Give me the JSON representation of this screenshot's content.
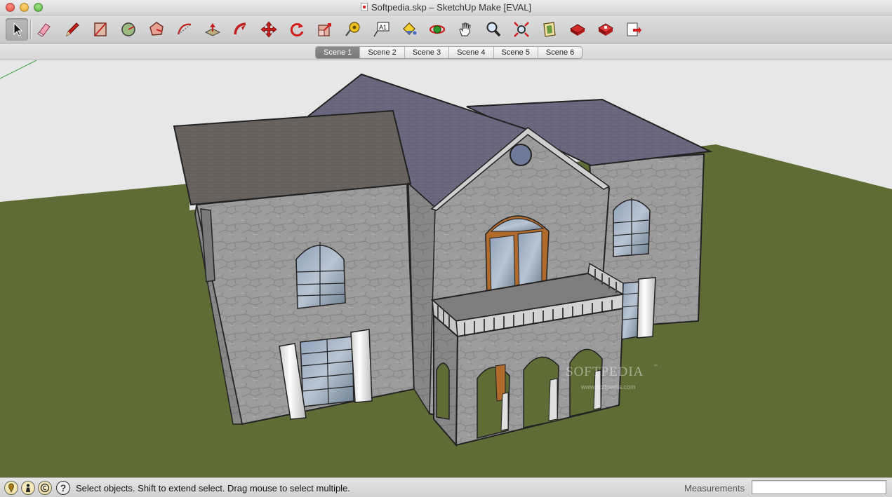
{
  "window": {
    "title": "Softpedia.skp – SketchUp Make [EVAL]"
  },
  "toolbar": {
    "tools": [
      {
        "name": "select-tool-icon",
        "active": true
      },
      {
        "name": "eraser-tool-icon"
      },
      {
        "name": "pencil-tool-icon"
      },
      {
        "name": "rectangle-tool-icon"
      },
      {
        "name": "circle-tool-icon"
      },
      {
        "name": "polygon-tool-icon"
      },
      {
        "name": "arc-tool-icon"
      },
      {
        "name": "push-pull-tool-icon"
      },
      {
        "name": "follow-me-tool-icon"
      },
      {
        "name": "move-tool-icon"
      },
      {
        "name": "rotate-tool-icon"
      },
      {
        "name": "scale-tool-icon"
      },
      {
        "name": "tape-measure-tool-icon"
      },
      {
        "name": "text-tool-icon",
        "glyph": "A1"
      },
      {
        "name": "paint-bucket-tool-icon"
      },
      {
        "name": "orbit-tool-icon"
      },
      {
        "name": "pan-tool-icon"
      },
      {
        "name": "zoom-tool-icon"
      },
      {
        "name": "zoom-extents-tool-icon"
      },
      {
        "name": "section-plane-tool-icon"
      },
      {
        "name": "3d-warehouse-icon"
      },
      {
        "name": "extension-warehouse-icon"
      },
      {
        "name": "send-to-layout-icon"
      }
    ]
  },
  "scenes": {
    "tabs": [
      "Scene 1",
      "Scene 2",
      "Scene 3",
      "Scene 4",
      "Scene 5",
      "Scene 6"
    ],
    "active_index": 0
  },
  "viewport": {
    "colors": {
      "sky": "#e7e7e7",
      "ground": "#5f6c35",
      "wall": "#9b9b9b",
      "roof": "#6d6764",
      "roof_back": "#6e6a82",
      "window_frame": "#b06a2c"
    },
    "watermark": {
      "brand": "SOFTPEDIA",
      "trademark": "™",
      "url": "www.softpedia.com"
    }
  },
  "status": {
    "icons": [
      "geo-location-icon",
      "credits-icon",
      "copyright-icon",
      "help-icon"
    ],
    "help_glyph": "?",
    "instruction": "Select objects. Shift to extend select. Drag mouse to select multiple.",
    "measurements_label": "Measurements",
    "measurements_value": ""
  }
}
